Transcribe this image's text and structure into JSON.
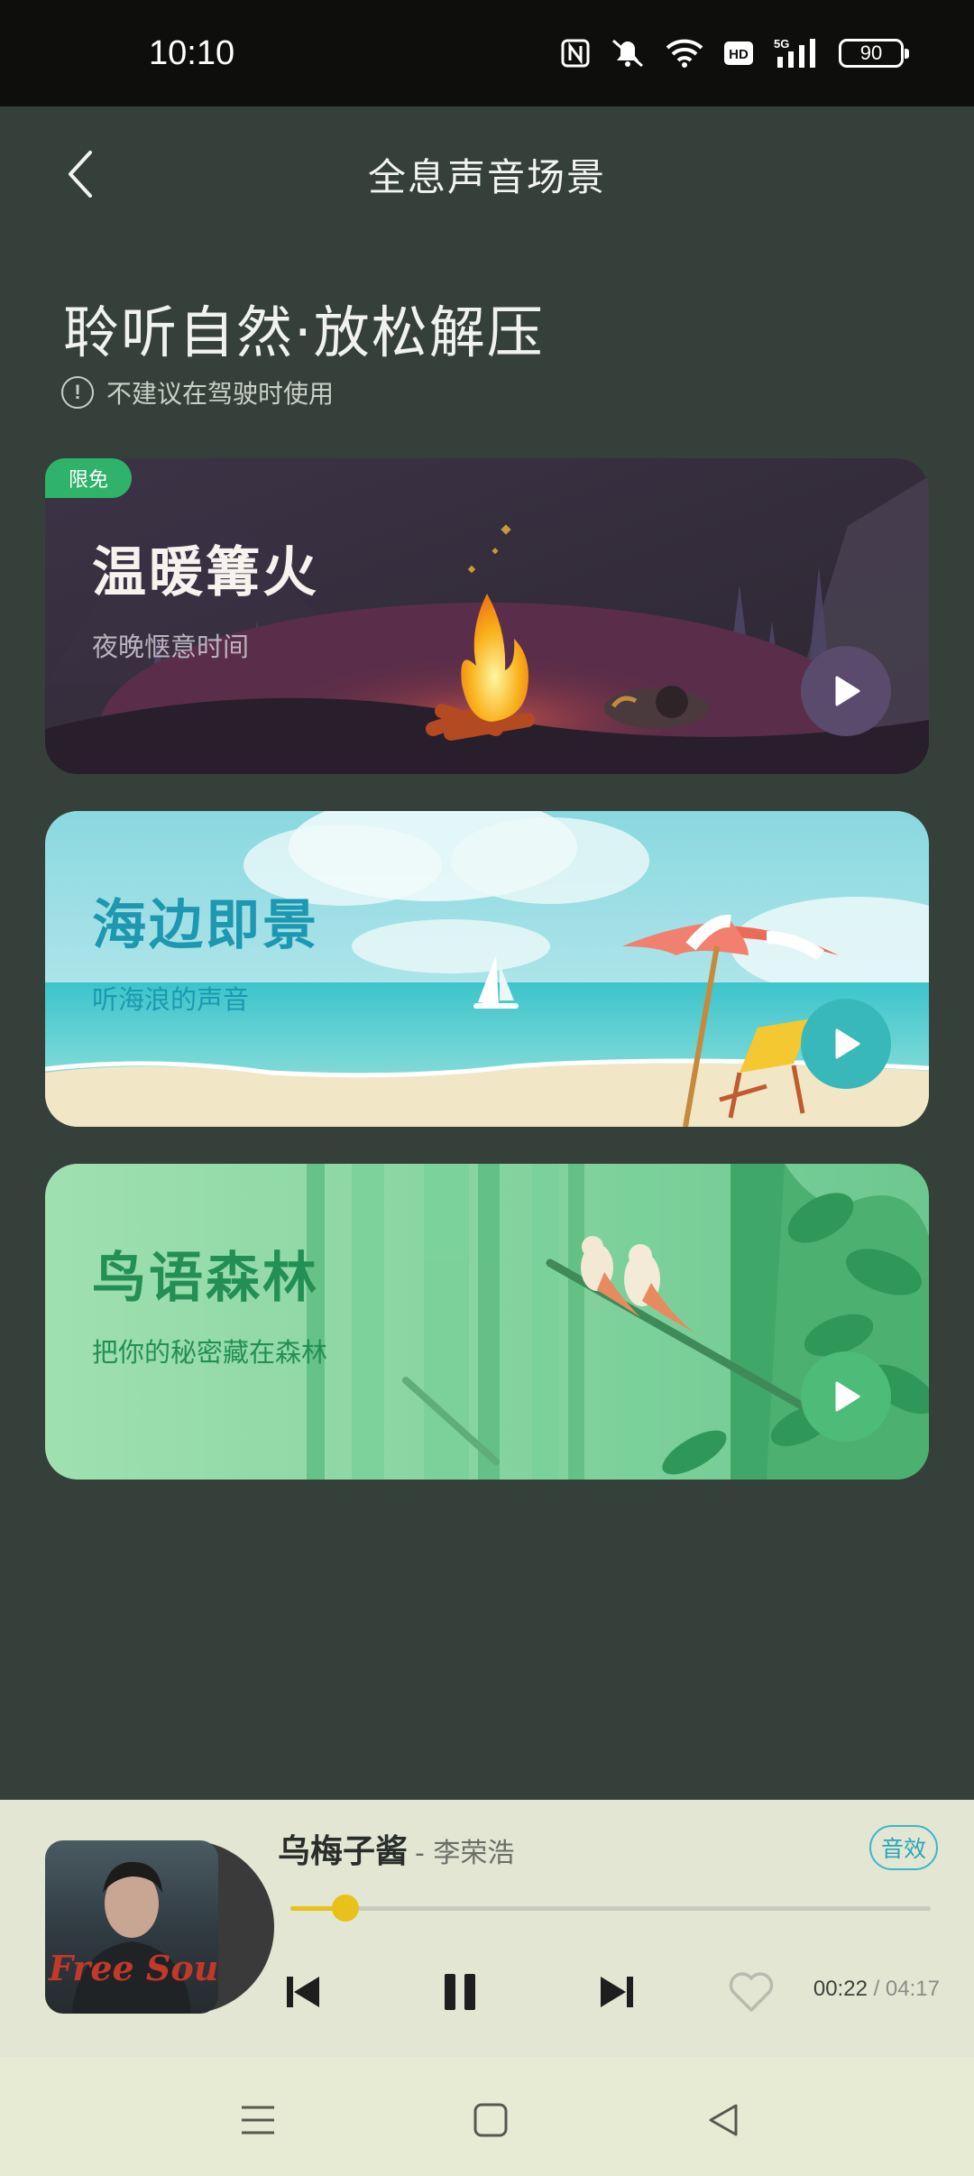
{
  "status_bar": {
    "time": "10:10",
    "battery": "90"
  },
  "header": {
    "title": "全息声音场景"
  },
  "intro": {
    "title": "聆听自然·放松解压",
    "warning": "不建议在驾驶时使用"
  },
  "cards": [
    {
      "badge": "限免",
      "title": "温暖篝火",
      "subtitle": "夜晚惬意时间"
    },
    {
      "title": "海边即景",
      "subtitle": "听海浪的声音"
    },
    {
      "title": "鸟语森林",
      "subtitle": "把你的秘密藏在森林"
    }
  ],
  "player": {
    "song": "乌梅子酱",
    "artist": "- 李荣浩",
    "effects_label": "音效",
    "cover_text": "Free Soul",
    "current_time": "00:22",
    "total_time": "/ 04:17",
    "progress": 0.086
  },
  "colors": {
    "accent": "#e8c21a",
    "badge": "#2fb36a",
    "fx": "#3fb6c8"
  }
}
